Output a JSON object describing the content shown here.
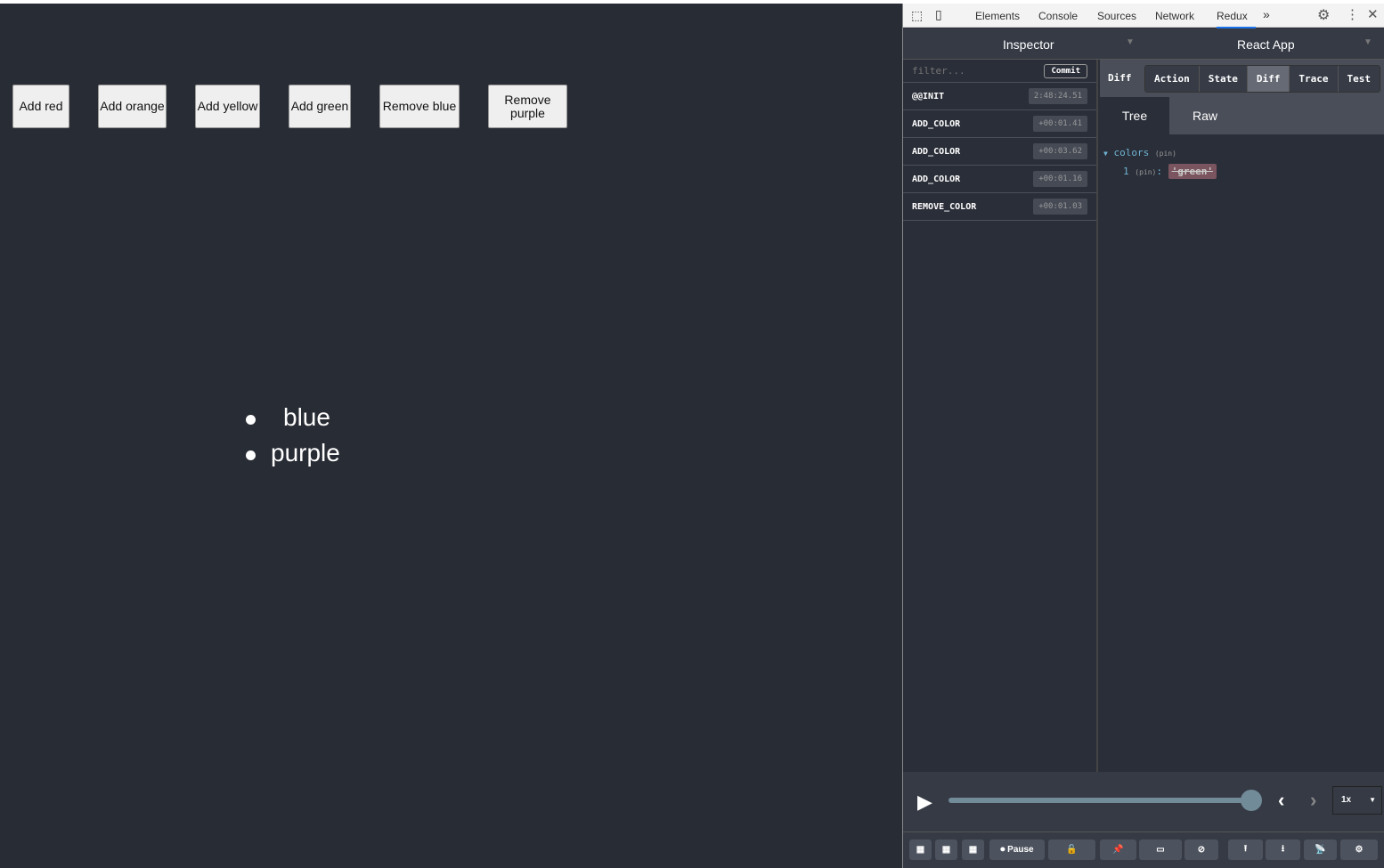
{
  "app": {
    "buttons": [
      "Add red",
      "Add orange",
      "Add yellow",
      "Add green",
      "Remove blue",
      "Remove purple"
    ],
    "list": [
      "blue",
      "purple"
    ]
  },
  "devtools": {
    "tabs": [
      "Elements",
      "Console",
      "Sources",
      "Network",
      "Redux"
    ],
    "active_tab": "Redux",
    "more": "»",
    "monitor": "Inspector",
    "instance": "React App",
    "filter_placeholder": "filter...",
    "commit": "Commit",
    "actions": [
      {
        "name": "@@INIT",
        "time": "2:48:24.51"
      },
      {
        "name": "ADD_COLOR",
        "time": "+00:01.41"
      },
      {
        "name": "ADD_COLOR",
        "time": "+00:03.62"
      },
      {
        "name": "ADD_COLOR",
        "time": "+00:01.16"
      },
      {
        "name": "REMOVE_COLOR",
        "time": "+00:01.03"
      }
    ],
    "diff_label": "Diff",
    "detail_tabs": [
      "Action",
      "State",
      "Diff",
      "Trace",
      "Test"
    ],
    "active_detail": "Diff",
    "view_tabs": [
      "Tree",
      "Raw"
    ],
    "active_view": "Tree",
    "tree": {
      "key": "colors",
      "pin": "(pin)",
      "child_key": "1",
      "child_pin": "(pin)",
      "removed_value": "'green'"
    },
    "slider_progress": 1.0,
    "speed": "1x",
    "pause": "Pause"
  }
}
